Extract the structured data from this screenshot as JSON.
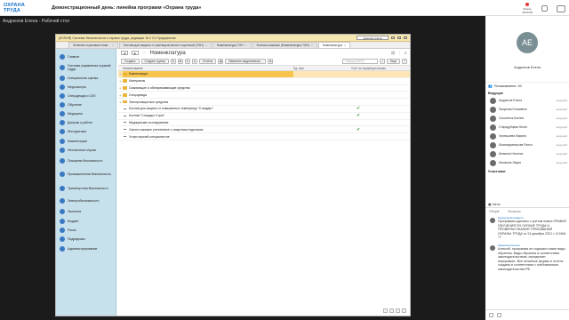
{
  "app": {
    "logo_line1": "ОХРАНА ТРУДА",
    "logo_line2": "",
    "meeting_title": "Демонстрационный день: линейка программ «Охрана труда»",
    "rec_label": "Запись",
    "rec_time": "00:06:58",
    "screen_owner": "Андрюхов Елена - Рабочий стол"
  },
  "window": {
    "title": "[КОПИЯ] Системы безопасности и охраны труда, редакция 16.2 1С:Предприятие",
    "search_label": "Администратор",
    "tabs": [
      {
        "label": "Зеленые страховые ножи...",
        "active": false
      },
      {
        "label": "Костюм для защиты от растворов кислот и щелочей (ТОН)",
        "active": false
      },
      {
        "label": "Номенклатура ТОН",
        "active": false
      },
      {
        "label": "Боттинк кожаные (Номенклатура ТОН)",
        "active": false
      },
      {
        "label": "Номенклатура",
        "active": true
      }
    ]
  },
  "sidebar": {
    "items": [
      {
        "label": "Главное",
        "color": "#3b78c3"
      },
      {
        "label": "Система управления охраной труда",
        "color": "#3b78c3"
      },
      {
        "label": "Специальная оценка",
        "color": "#3b78c3"
      },
      {
        "label": "Медосмотры",
        "color": "#3b78c3"
      },
      {
        "label": "Спецодежда и СИЗ",
        "color": "#3b78c3"
      },
      {
        "label": "Обучение",
        "color": "#3b78c3"
      },
      {
        "label": "Медицина",
        "color": "#3b78c3"
      },
      {
        "label": "Допуски к работе",
        "color": "#3b78c3"
      },
      {
        "label": "Инструктажи",
        "color": "#3b78c3"
      },
      {
        "label": "Компенсации",
        "color": "#3b78c3"
      },
      {
        "label": "Несчастные случаи",
        "color": "#3b78c3"
      },
      {
        "label": "Пожарная безопасность",
        "color": "#3b78c3"
      },
      {
        "label": "Промышленная безопасность",
        "color": "#3b78c3"
      },
      {
        "label": "Транспортная безопасность",
        "color": "#3b78c3"
      },
      {
        "label": "Электробезопасность",
        "color": "#3b78c3"
      },
      {
        "label": "Экология",
        "color": "#3b78c3"
      },
      {
        "label": "Бюджет",
        "color": "#3b78c3"
      },
      {
        "label": "Риски",
        "color": "#3b78c3"
      },
      {
        "label": "Подрядчики",
        "color": "#3b78c3"
      },
      {
        "label": "Администрирование",
        "color": "#3b78c3"
      }
    ]
  },
  "form": {
    "title": "Номенклатура",
    "toolbar": {
      "create": "Создать",
      "create_group": "Создать группу",
      "reports": "Отчеты",
      "change_selected": "Изменить выделенные...",
      "search_placeholder": "Поиск (Ctrl+F)",
      "more": "Еще"
    },
    "columns": [
      "Наименование",
      "Ед. изм.",
      "Учет по характеристикам"
    ],
    "rows": [
      {
        "type": "folder",
        "name": "Компенсации",
        "selected": true,
        "unit": "",
        "check": ""
      },
      {
        "type": "folder",
        "name": "Материалы",
        "selected": false,
        "unit": "",
        "check": ""
      },
      {
        "type": "folder",
        "name": "Смывающие и обезвреживающие средства",
        "selected": false,
        "unit": "",
        "check": ""
      },
      {
        "type": "folder",
        "name": "Спецодежда",
        "selected": false,
        "unit": "",
        "check": ""
      },
      {
        "type": "folder",
        "name": "Электрозащитные средства",
        "selected": false,
        "unit": "",
        "check": ""
      },
      {
        "type": "item",
        "name": "Костюм для защиты от повышенных температур \"Стандарт\"",
        "selected": false,
        "unit": "",
        "check": "✔"
      },
      {
        "type": "item",
        "name": "Костюм \"Стандарт Стрит\"",
        "selected": false,
        "unit": "",
        "check": "✔"
      },
      {
        "type": "item",
        "name": "Медицинские исследования",
        "selected": false,
        "unit": "",
        "check": ""
      },
      {
        "type": "item",
        "name": "Сапоги кожаные утепленные с защитным подноском",
        "selected": false,
        "unit": "",
        "check": "✔"
      },
      {
        "type": "item",
        "name": "Услуги врачей-специалистов",
        "selected": false,
        "unit": "",
        "check": ""
      }
    ]
  },
  "rightpanel": {
    "avatar_initials": "АЕ",
    "avatar_name": "Андрюхов Елена",
    "users_label": "Пользователи",
    "users_count": "40",
    "section_leaders": "Ведущие",
    "leaders": [
      {
        "name": "Андрюхов Елена",
        "role": "ведущий"
      },
      {
        "name": "Пикунова Елизавета",
        "role": "ведущий"
      },
      {
        "name": "Соколенок Ксения",
        "role": "ведущий"
      },
      {
        "name": "Стародубцева Юлия",
        "role": "ведущий"
      },
      {
        "name": "Чернышева Марина",
        "role": "ведущий"
      },
      {
        "name": "Шахмеджанирова Раиса",
        "role": "ведущий"
      },
      {
        "name": "Шевкина Наталья",
        "role": "ведущий"
      },
      {
        "name": "Шишкина Лидия",
        "role": "ведущий"
      }
    ],
    "section_participants": "Участники",
    "chat_tabs": [
      "Общий",
      "Вопросы"
    ],
    "chat_label": "Чаты",
    "messages": [
      {
        "author": "Пикунова Елизавета",
        "text": "Программы сделаны с учетом новых ПРАВИЛ ОБУЧЕНИЯ ПО ОХРАНЕ ТРУДА И ПРОВЕРКИ ЗНАНИЯ ТРЕБОВАНИЙ ОХРАНЫ ТРУДА от 24 декабря 2021 г. N 2464 ??"
      },
      {
        "author": "Шевкина Наталья",
        "text": "Алексей, программа не содержит какие виды обучения. Виды обучения в соответствии законодательством, определяет перерывом...Все печатные формы и отчеты созданы в соответствии с требованиями законодательства РФ."
      }
    ]
  }
}
